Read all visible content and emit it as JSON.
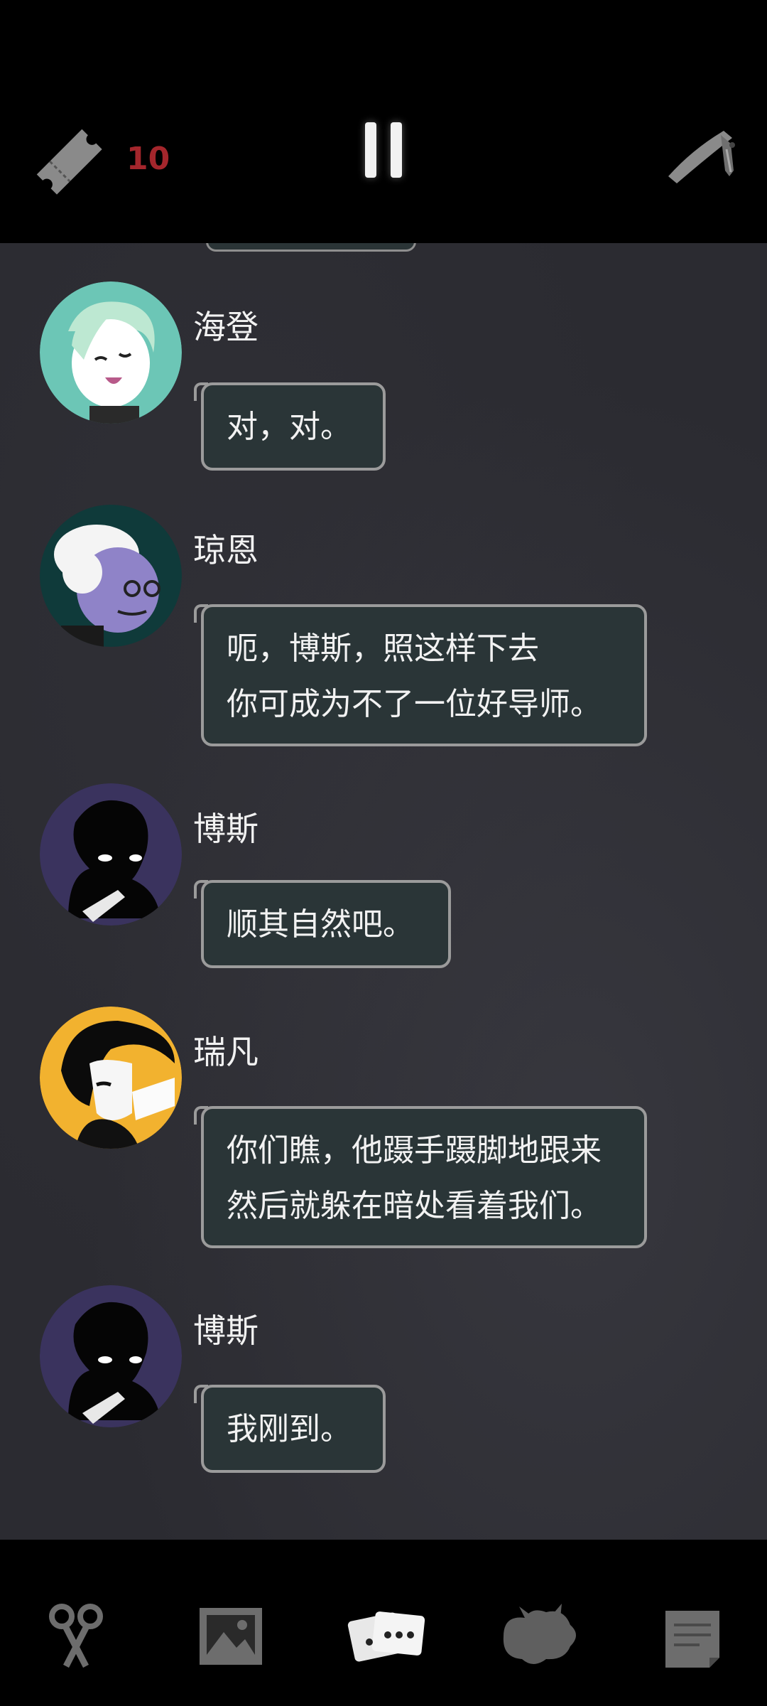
{
  "top_bar": {
    "ticket_count": "10",
    "ticket_icon": "ticket-icon",
    "pause_icon": "pause-icon",
    "knife_icon": "knife-icon"
  },
  "messages": [
    {
      "speaker": "海登",
      "lines": [
        "对，对。"
      ],
      "avatar": "avatar-hayden",
      "avatar_color": "#6cc6b6"
    },
    {
      "speaker": "琼恩",
      "lines": [
        "呃，博斯，照这样下去",
        "你可成为不了一位好导师。"
      ],
      "avatar": "avatar-joan",
      "avatar_color": "#0f3a3a"
    },
    {
      "speaker": "博斯",
      "lines": [
        "顺其自然吧。"
      ],
      "avatar": "avatar-boss",
      "avatar_color": "#3a335e"
    },
    {
      "speaker": "瑞凡",
      "lines": [
        "你们瞧，他蹑手蹑脚地跟来",
        "然后就躲在暗处看着我们。"
      ],
      "avatar": "avatar-ruifan",
      "avatar_color": "#f2b22f"
    },
    {
      "speaker": "博斯",
      "lines": [
        "我刚到。"
      ],
      "avatar": "avatar-boss",
      "avatar_color": "#3a335e"
    }
  ],
  "bottom_nav": [
    {
      "icon": "scissors-icon"
    },
    {
      "icon": "gallery-icon"
    },
    {
      "icon": "chat-cards-icon",
      "active": true
    },
    {
      "icon": "creature-icon"
    },
    {
      "icon": "notes-icon"
    }
  ],
  "colors": {
    "ticket_count": "#a4262c",
    "bubble_bg": "#2a3537",
    "bubble_border": "#9b9b9b",
    "chat_bg": "#2b2b31"
  }
}
